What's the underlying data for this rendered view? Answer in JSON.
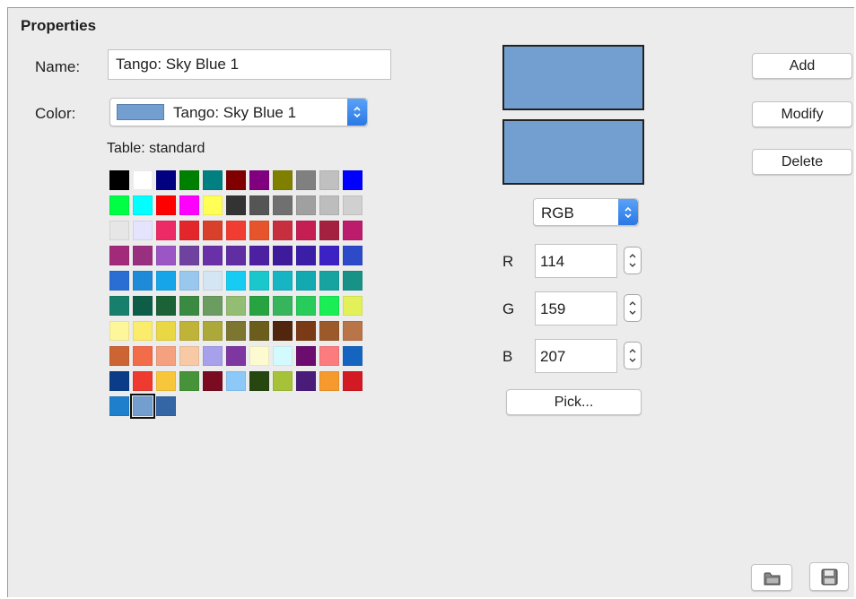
{
  "properties": {
    "title": "Properties",
    "name_label": "Name:",
    "name_value": "Tango: Sky Blue 1",
    "color_label": "Color:",
    "color_value": "Tango: Sky Blue 1",
    "color_swatch": "#729fcf",
    "table_label": "Table: standard"
  },
  "palette": [
    "#000000",
    "#ffffff",
    "#000080",
    "#008000",
    "#008080",
    "#800000",
    "#800080",
    "#808000",
    "#808080",
    "#c0c0c0",
    "#0000ff",
    "#00ff44",
    "#00ffff",
    "#ff0000",
    "#ff00ff",
    "#ffff55",
    "#333333",
    "#555555",
    "#707070",
    "#a0a0a0",
    "#bdbdbd",
    "#d0d0d0",
    "#e6e6e6",
    "#e4e4ff",
    "#ee2a66",
    "#e3262b",
    "#d8402c",
    "#f13c32",
    "#e6542c",
    "#c72f3f",
    "#c41e52",
    "#a42140",
    "#bb1c6b",
    "#a32a7a",
    "#99307f",
    "#9b55c4",
    "#6f42a0",
    "#6930a8",
    "#612da3",
    "#4d20a2",
    "#3e1b9a",
    "#3a1ea7",
    "#3c21c5",
    "#2d4ac8",
    "#2a6dd3",
    "#1e8ad8",
    "#16a5e8",
    "#9ac7ee",
    "#d4e6f4",
    "#16ccf2",
    "#19c7cc",
    "#16b5c3",
    "#12a9b1",
    "#17a3a0",
    "#189187",
    "#17806d",
    "#0e5e47",
    "#1b6237",
    "#3b8a42",
    "#6b9c60",
    "#93bd72",
    "#27a342",
    "#36b55d",
    "#27cc5b",
    "#19ee55",
    "#e2f15a",
    "#fdf69a",
    "#fbec6b",
    "#e9d843",
    "#bfb33a",
    "#ada83a",
    "#7c7631",
    "#6b5e1d",
    "#52250e",
    "#7a3a16",
    "#9c5a2a",
    "#b97448",
    "#cc6433",
    "#f26c4a",
    "#f5a07e",
    "#f7c9a5",
    "#a7a0ea",
    "#7e36a1",
    "#fdf9d0",
    "#d3fbff",
    "#6b0c6e",
    "#fb7b7e",
    "#1565c0",
    "#0a3c87",
    "#ef3a2f",
    "#f8c63b",
    "#479339",
    "#7a0b21",
    "#8cc8f8",
    "#264710",
    "#a6c238",
    "#4a1c79",
    "#f79a2e",
    "#d31a22",
    "#1e7fcc",
    "#729fcf",
    "#3465a4"
  ],
  "selected_index": 100,
  "preview": {
    "old_color": "#729fcf",
    "new_color": "#729fcf"
  },
  "color_model": {
    "label": "RGB"
  },
  "channels": [
    {
      "label": "R",
      "value": "114"
    },
    {
      "label": "G",
      "value": "159"
    },
    {
      "label": "B",
      "value": "207"
    }
  ],
  "buttons": {
    "pick": "Pick...",
    "add": "Add",
    "modify": "Modify",
    "delete": "Delete"
  },
  "icons": {
    "open": "folder-icon",
    "save": "floppy-disk-icon"
  }
}
